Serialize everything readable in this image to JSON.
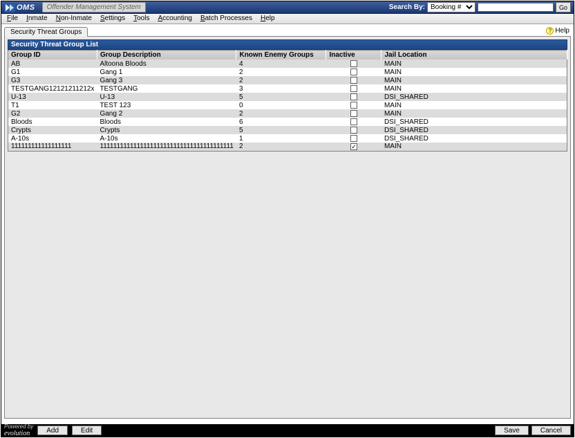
{
  "header": {
    "logo_text": "OMS",
    "system_title": "Offender Management System",
    "search_label": "Search By:",
    "search_select": "Booking #",
    "search_value": "",
    "go_label": "Go"
  },
  "menubar": {
    "items": [
      "File",
      "Inmate",
      "Non-Inmate",
      "Settings",
      "Tools",
      "Accounting",
      "Batch Processes",
      "Help"
    ]
  },
  "tab": {
    "label": "Security Threat Groups"
  },
  "help": {
    "label": "Help"
  },
  "list": {
    "title": "Security Threat Group List",
    "columns": [
      "Group ID",
      "Group Description",
      "Known Enemy Groups",
      "Inactive",
      "Jail Location"
    ],
    "rows": [
      {
        "id": "AB",
        "desc": "Altoona Bloods",
        "enemy": "4",
        "inactive": false,
        "jail": "MAIN"
      },
      {
        "id": "G1",
        "desc": "Gang 1",
        "enemy": "2",
        "inactive": false,
        "jail": "MAIN"
      },
      {
        "id": "G3",
        "desc": "Gang 3",
        "enemy": "2",
        "inactive": false,
        "jail": "MAIN"
      },
      {
        "id": "TESTGANG12121211212x",
        "desc": "TESTGANG",
        "enemy": "3",
        "inactive": false,
        "jail": "MAIN"
      },
      {
        "id": "U-13",
        "desc": "U-13",
        "enemy": "5",
        "inactive": false,
        "jail": "DSI_SHARED"
      },
      {
        "id": "T1",
        "desc": "TEST 123",
        "enemy": "0",
        "inactive": false,
        "jail": "MAIN"
      },
      {
        "id": "G2",
        "desc": "Gang 2",
        "enemy": "2",
        "inactive": false,
        "jail": "MAIN"
      },
      {
        "id": "Bloods",
        "desc": "Bloods",
        "enemy": "6",
        "inactive": false,
        "jail": "DSI_SHARED"
      },
      {
        "id": "Crypts",
        "desc": "Crypts",
        "enemy": "5",
        "inactive": false,
        "jail": "DSI_SHARED"
      },
      {
        "id": "A-10s",
        "desc": "A-10s",
        "enemy": "1",
        "inactive": false,
        "jail": "DSI_SHARED"
      },
      {
        "id": "111111111111111111",
        "desc": "1111111111111111111111111111111111111111",
        "enemy": "2",
        "inactive": true,
        "jail": "MAIN"
      }
    ]
  },
  "footer": {
    "powered_label": "Powered by",
    "powered_brand": "evolution",
    "add_label": "Add",
    "edit_label": "Edit",
    "save_label": "Save",
    "cancel_label": "Cancel"
  }
}
